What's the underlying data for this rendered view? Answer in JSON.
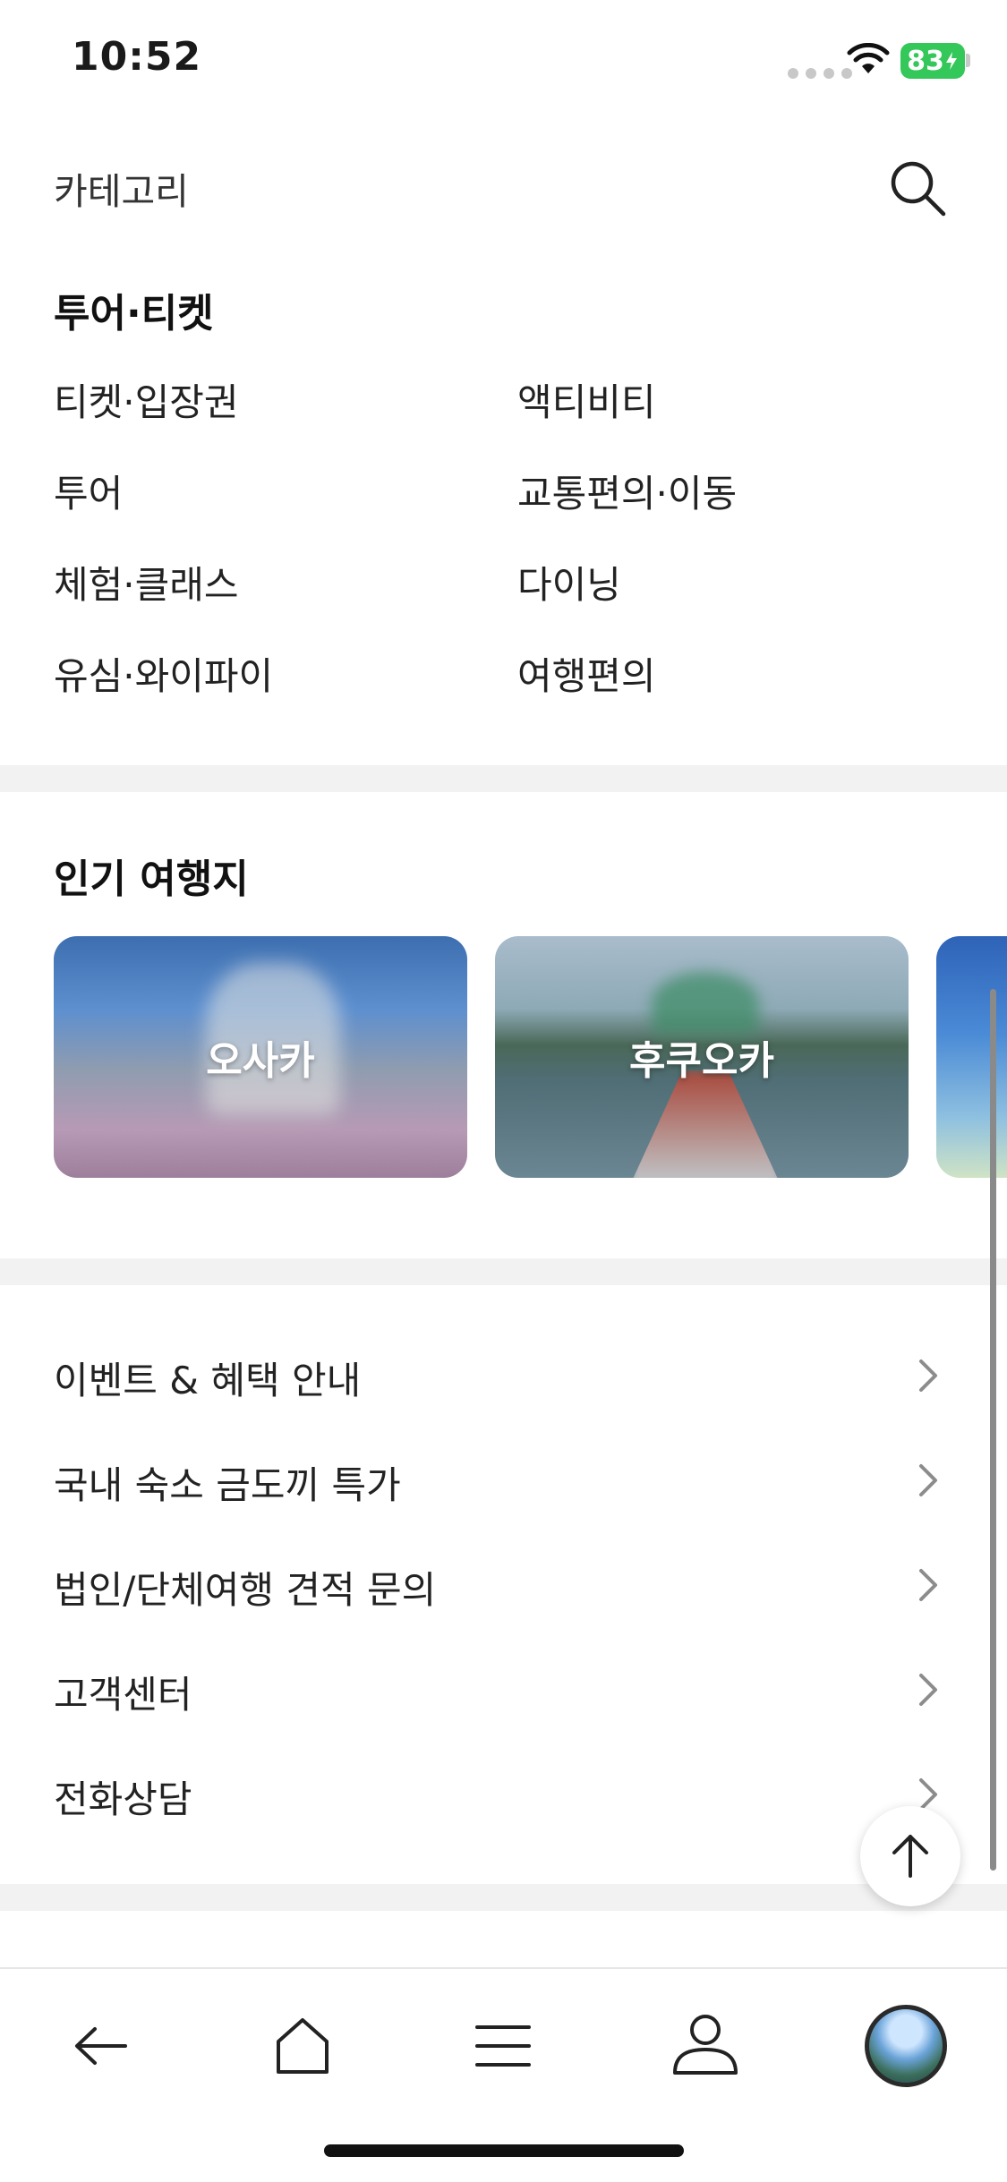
{
  "status_bar": {
    "time": "10:52",
    "battery": "83"
  },
  "header": {
    "title": "카테고리",
    "search_icon": "search-icon"
  },
  "tour_ticket": {
    "title": "투어·티켓",
    "items": [
      "티켓·입장권",
      "액티비티",
      "투어",
      "교통편의·이동",
      "체험·클래스",
      "다이닝",
      "유심·와이파이",
      "여행편의"
    ]
  },
  "popular": {
    "title": "인기 여행지",
    "destinations": [
      {
        "name": "오사카"
      },
      {
        "name": "후쿠오카"
      },
      {
        "name": ""
      }
    ]
  },
  "menu": {
    "items": [
      "이벤트 & 혜택 안내",
      "국내 숙소 금도끼 특가",
      "법인/단체여행 견적 문의",
      "고객센터",
      "전화상담"
    ]
  },
  "bottom_nav": {
    "icons": [
      "back-arrow-icon",
      "home-icon",
      "menu-icon",
      "user-icon",
      "avatar"
    ]
  },
  "colors": {
    "battery": "#34c759",
    "divider": "#f2f2f2",
    "text": "#222222"
  }
}
